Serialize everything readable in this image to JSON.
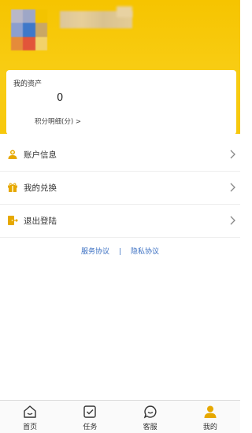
{
  "colors": {
    "header_yellow": "#f7c80c",
    "icon_gold": "#e6a800",
    "link_blue": "#3a6fc2",
    "text_dark": "#333333"
  },
  "profile": {
    "avatar": "blurred-avatar",
    "nickname": ""
  },
  "assets": {
    "title": "我的资产",
    "value": "0",
    "detail_link": "积分明细(分) >"
  },
  "menu": [
    {
      "label": "账户信息",
      "icon": "user-icon"
    },
    {
      "label": "我的兑换",
      "icon": "gift-icon"
    },
    {
      "label": "退出登陆",
      "icon": "logout-icon"
    }
  ],
  "links": {
    "service": "服务协议",
    "separator": "|",
    "privacy": "隐私协议"
  },
  "tabbar": [
    {
      "label": "首页",
      "icon": "home-icon"
    },
    {
      "label": "任务",
      "icon": "task-icon"
    },
    {
      "label": "客服",
      "icon": "chat-icon"
    },
    {
      "label": "我的",
      "icon": "profile-icon",
      "active": true
    }
  ]
}
